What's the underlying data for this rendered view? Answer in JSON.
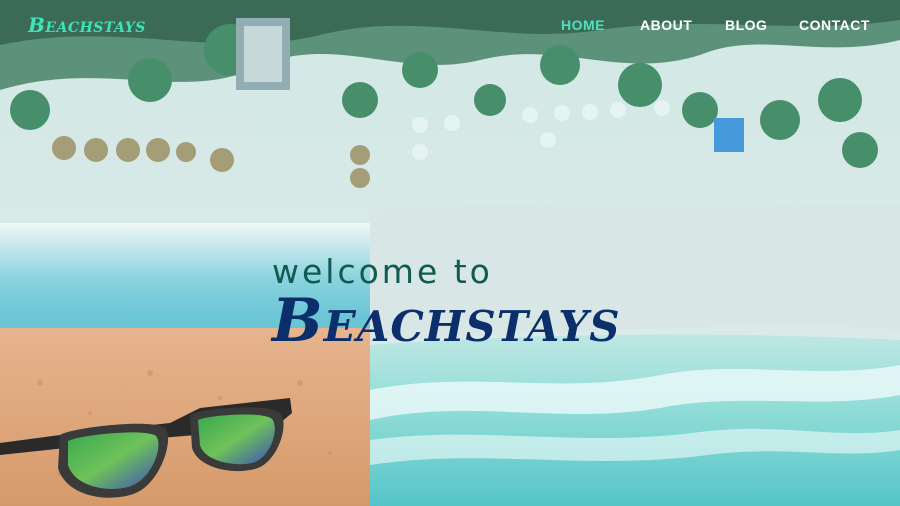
{
  "brand": {
    "logo_text": "Beachstays"
  },
  "nav": {
    "items": [
      {
        "label": "HOME",
        "active": true
      },
      {
        "label": "ABOUT",
        "active": false
      },
      {
        "label": "BLOG",
        "active": false
      },
      {
        "label": "CONTACT",
        "active": false
      }
    ]
  },
  "hero": {
    "welcome_text": "welcome to",
    "title": "Beachstays"
  },
  "colors": {
    "accent_teal": "#4fe0bb",
    "title_navy": "#0b2f6b",
    "welcome_green": "#0f5b52"
  }
}
